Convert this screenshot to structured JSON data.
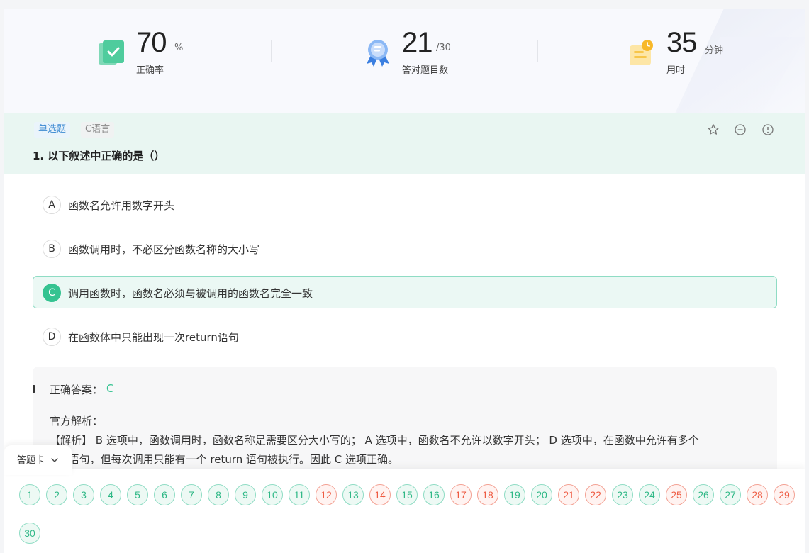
{
  "stats": [
    {
      "value": "70",
      "unit": "%",
      "label": "正确率",
      "icon": "checklist-icon"
    },
    {
      "value": "21",
      "unit": "/30",
      "label": "答对题目数",
      "icon": "award-ribbon-icon"
    },
    {
      "value": "35",
      "unit": "分钟",
      "label": "用时",
      "icon": "clock-notepad-icon"
    }
  ],
  "question": {
    "type_tag": "单选题",
    "subject_tag": "C语言",
    "title": "1. 以下叙述中正确的是（）",
    "options": [
      {
        "letter": "A",
        "text": "函数名允许用数字开头"
      },
      {
        "letter": "B",
        "text": "函数调用时，不必区分函数名称的大小写"
      },
      {
        "letter": "C",
        "text": "调用函数时，函数名必须与被调用的函数名完全一致",
        "selected": true
      },
      {
        "letter": "D",
        "text": "在函数体中只能出现一次return语句"
      }
    ]
  },
  "analysis": {
    "answer_label": "正确答案：",
    "answer_value": "C",
    "title": "官方解析：",
    "line1": "【解析】 B 选项中，函数调用时，函数名称是需要区分大小写的； A 选项中，函数名不允许以数字开头； D 选项中，在函数中允许有多个",
    "line2": "return 语句，但每次调用只能有一个 return 语句被执行。因此 C 选项正确。"
  },
  "answer_card": {
    "label": "答题卡",
    "items": [
      {
        "n": "1",
        "s": "ok"
      },
      {
        "n": "2",
        "s": "ok"
      },
      {
        "n": "3",
        "s": "ok"
      },
      {
        "n": "4",
        "s": "ok"
      },
      {
        "n": "5",
        "s": "ok"
      },
      {
        "n": "6",
        "s": "ok"
      },
      {
        "n": "7",
        "s": "ok"
      },
      {
        "n": "8",
        "s": "ok"
      },
      {
        "n": "9",
        "s": "ok"
      },
      {
        "n": "10",
        "s": "ok"
      },
      {
        "n": "11",
        "s": "ok"
      },
      {
        "n": "12",
        "s": "bad"
      },
      {
        "n": "13",
        "s": "ok"
      },
      {
        "n": "14",
        "s": "bad"
      },
      {
        "n": "15",
        "s": "ok"
      },
      {
        "n": "16",
        "s": "ok"
      },
      {
        "n": "17",
        "s": "bad"
      },
      {
        "n": "18",
        "s": "bad"
      },
      {
        "n": "19",
        "s": "ok"
      },
      {
        "n": "20",
        "s": "ok"
      },
      {
        "n": "21",
        "s": "bad"
      },
      {
        "n": "22",
        "s": "bad"
      },
      {
        "n": "23",
        "s": "ok"
      },
      {
        "n": "24",
        "s": "ok"
      },
      {
        "n": "25",
        "s": "bad"
      },
      {
        "n": "26",
        "s": "ok"
      },
      {
        "n": "27",
        "s": "ok"
      },
      {
        "n": "28",
        "s": "bad"
      },
      {
        "n": "29",
        "s": "bad"
      },
      {
        "n": "30",
        "s": "ok"
      }
    ]
  },
  "colors": {
    "accent": "#35c391",
    "correct": "#2fb886",
    "wrong": "#ee5b42",
    "tag_blue": "#3e8bd2"
  }
}
